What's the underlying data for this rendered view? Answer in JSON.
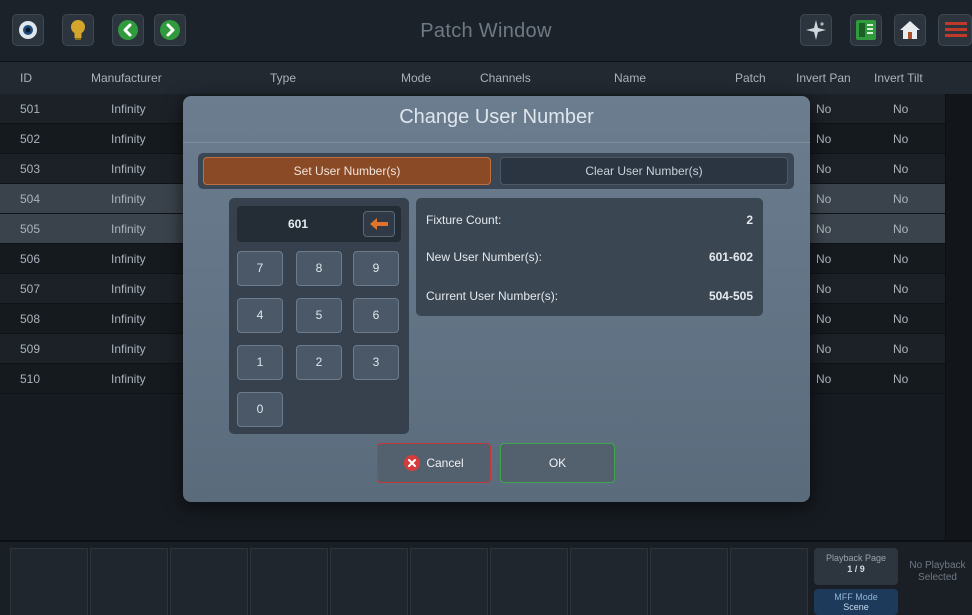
{
  "window": {
    "title": "Patch Window"
  },
  "toolbar_left": [
    {
      "icon": "eye-icon",
      "color": "#1e4c7a"
    },
    {
      "icon": "lightbulb-icon",
      "color": "#d3a62b"
    },
    {
      "icon": "chevron-left-icon",
      "color": "#2f9b3c"
    },
    {
      "icon": "chevron-right-icon",
      "color": "#2f9b3c"
    }
  ],
  "toolbar_right": [
    {
      "icon": "sparkle-icon"
    },
    {
      "icon": "grid-icon"
    },
    {
      "icon": "home-icon"
    },
    {
      "icon": "menu-icon"
    }
  ],
  "table": {
    "columns": [
      "ID",
      "Manufacturer",
      "Type",
      "Mode",
      "Channels",
      "Name",
      "Patch",
      "Invert Pan",
      "Invert Tilt"
    ],
    "rows": [
      {
        "id": "501",
        "manufacturer": "Infinity",
        "invert_pan": "No",
        "invert_tilt": "No",
        "selected": false
      },
      {
        "id": "502",
        "manufacturer": "Infinity",
        "invert_pan": "No",
        "invert_tilt": "No",
        "selected": false
      },
      {
        "id": "503",
        "manufacturer": "Infinity",
        "invert_pan": "No",
        "invert_tilt": "No",
        "selected": false
      },
      {
        "id": "504",
        "manufacturer": "Infinity",
        "invert_pan": "No",
        "invert_tilt": "No",
        "selected": true
      },
      {
        "id": "505",
        "manufacturer": "Infinity",
        "invert_pan": "No",
        "invert_tilt": "No",
        "selected": true
      },
      {
        "id": "506",
        "manufacturer": "Infinity",
        "invert_pan": "No",
        "invert_tilt": "No",
        "selected": false
      },
      {
        "id": "507",
        "manufacturer": "Infinity",
        "invert_pan": "No",
        "invert_tilt": "No",
        "selected": false
      },
      {
        "id": "508",
        "manufacturer": "Infinity",
        "invert_pan": "No",
        "invert_tilt": "No",
        "selected": false
      },
      {
        "id": "509",
        "manufacturer": "Infinity",
        "invert_pan": "No",
        "invert_tilt": "No",
        "selected": false
      },
      {
        "id": "510",
        "manufacturer": "Infinity",
        "invert_pan": "No",
        "invert_tilt": "No",
        "selected": false
      }
    ]
  },
  "dialog": {
    "title": "Change User Number",
    "tabs": {
      "set": "Set User Number(s)",
      "clear": "Clear User Number(s)"
    },
    "display_value": "601",
    "keys": [
      "7",
      "8",
      "9",
      "4",
      "5",
      "6",
      "1",
      "2",
      "3",
      "0"
    ],
    "info": {
      "fixture_count_label": "Fixture Count:",
      "fixture_count_value": "2",
      "new_label": "New User Number(s):",
      "new_value": "601-602",
      "current_label": "Current User Number(s):",
      "current_value": "504-505"
    },
    "cancel_label": "Cancel",
    "ok_label": "OK"
  },
  "bottom": {
    "playback_page_label": "Playback Page",
    "playback_page_value": "1 / 9",
    "mff_mode_label": "MFF Mode",
    "mff_mode_value": "Scene",
    "no_playback": "No Playback Selected"
  },
  "colors": {
    "accent_orange": "#8a4a26",
    "cancel_border": "#c23a3a",
    "ok_border": "#3fa64a",
    "mff_blue": "#1d3a5a"
  }
}
